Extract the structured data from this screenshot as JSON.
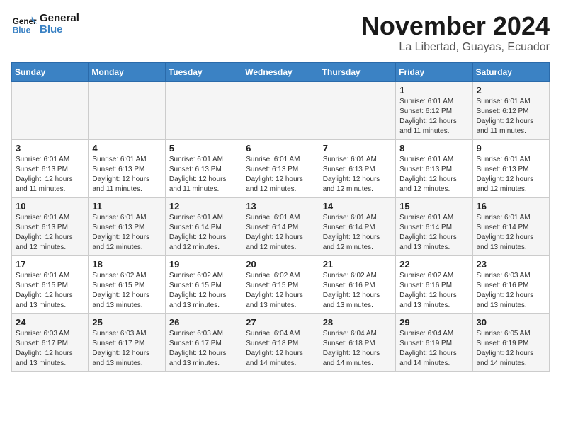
{
  "logo": {
    "line1": "General",
    "line2": "Blue"
  },
  "title": "November 2024",
  "subtitle": "La Libertad, Guayas, Ecuador",
  "days_of_week": [
    "Sunday",
    "Monday",
    "Tuesday",
    "Wednesday",
    "Thursday",
    "Friday",
    "Saturday"
  ],
  "weeks": [
    [
      {
        "day": "",
        "info": ""
      },
      {
        "day": "",
        "info": ""
      },
      {
        "day": "",
        "info": ""
      },
      {
        "day": "",
        "info": ""
      },
      {
        "day": "",
        "info": ""
      },
      {
        "day": "1",
        "info": "Sunrise: 6:01 AM\nSunset: 6:12 PM\nDaylight: 12 hours and 11 minutes."
      },
      {
        "day": "2",
        "info": "Sunrise: 6:01 AM\nSunset: 6:12 PM\nDaylight: 12 hours and 11 minutes."
      }
    ],
    [
      {
        "day": "3",
        "info": "Sunrise: 6:01 AM\nSunset: 6:13 PM\nDaylight: 12 hours and 11 minutes."
      },
      {
        "day": "4",
        "info": "Sunrise: 6:01 AM\nSunset: 6:13 PM\nDaylight: 12 hours and 11 minutes."
      },
      {
        "day": "5",
        "info": "Sunrise: 6:01 AM\nSunset: 6:13 PM\nDaylight: 12 hours and 11 minutes."
      },
      {
        "day": "6",
        "info": "Sunrise: 6:01 AM\nSunset: 6:13 PM\nDaylight: 12 hours and 12 minutes."
      },
      {
        "day": "7",
        "info": "Sunrise: 6:01 AM\nSunset: 6:13 PM\nDaylight: 12 hours and 12 minutes."
      },
      {
        "day": "8",
        "info": "Sunrise: 6:01 AM\nSunset: 6:13 PM\nDaylight: 12 hours and 12 minutes."
      },
      {
        "day": "9",
        "info": "Sunrise: 6:01 AM\nSunset: 6:13 PM\nDaylight: 12 hours and 12 minutes."
      }
    ],
    [
      {
        "day": "10",
        "info": "Sunrise: 6:01 AM\nSunset: 6:13 PM\nDaylight: 12 hours and 12 minutes."
      },
      {
        "day": "11",
        "info": "Sunrise: 6:01 AM\nSunset: 6:13 PM\nDaylight: 12 hours and 12 minutes."
      },
      {
        "day": "12",
        "info": "Sunrise: 6:01 AM\nSunset: 6:14 PM\nDaylight: 12 hours and 12 minutes."
      },
      {
        "day": "13",
        "info": "Sunrise: 6:01 AM\nSunset: 6:14 PM\nDaylight: 12 hours and 12 minutes."
      },
      {
        "day": "14",
        "info": "Sunrise: 6:01 AM\nSunset: 6:14 PM\nDaylight: 12 hours and 12 minutes."
      },
      {
        "day": "15",
        "info": "Sunrise: 6:01 AM\nSunset: 6:14 PM\nDaylight: 12 hours and 13 minutes."
      },
      {
        "day": "16",
        "info": "Sunrise: 6:01 AM\nSunset: 6:14 PM\nDaylight: 12 hours and 13 minutes."
      }
    ],
    [
      {
        "day": "17",
        "info": "Sunrise: 6:01 AM\nSunset: 6:15 PM\nDaylight: 12 hours and 13 minutes."
      },
      {
        "day": "18",
        "info": "Sunrise: 6:02 AM\nSunset: 6:15 PM\nDaylight: 12 hours and 13 minutes."
      },
      {
        "day": "19",
        "info": "Sunrise: 6:02 AM\nSunset: 6:15 PM\nDaylight: 12 hours and 13 minutes."
      },
      {
        "day": "20",
        "info": "Sunrise: 6:02 AM\nSunset: 6:15 PM\nDaylight: 12 hours and 13 minutes."
      },
      {
        "day": "21",
        "info": "Sunrise: 6:02 AM\nSunset: 6:16 PM\nDaylight: 12 hours and 13 minutes."
      },
      {
        "day": "22",
        "info": "Sunrise: 6:02 AM\nSunset: 6:16 PM\nDaylight: 12 hours and 13 minutes."
      },
      {
        "day": "23",
        "info": "Sunrise: 6:03 AM\nSunset: 6:16 PM\nDaylight: 12 hours and 13 minutes."
      }
    ],
    [
      {
        "day": "24",
        "info": "Sunrise: 6:03 AM\nSunset: 6:17 PM\nDaylight: 12 hours and 13 minutes."
      },
      {
        "day": "25",
        "info": "Sunrise: 6:03 AM\nSunset: 6:17 PM\nDaylight: 12 hours and 13 minutes."
      },
      {
        "day": "26",
        "info": "Sunrise: 6:03 AM\nSunset: 6:17 PM\nDaylight: 12 hours and 13 minutes."
      },
      {
        "day": "27",
        "info": "Sunrise: 6:04 AM\nSunset: 6:18 PM\nDaylight: 12 hours and 14 minutes."
      },
      {
        "day": "28",
        "info": "Sunrise: 6:04 AM\nSunset: 6:18 PM\nDaylight: 12 hours and 14 minutes."
      },
      {
        "day": "29",
        "info": "Sunrise: 6:04 AM\nSunset: 6:19 PM\nDaylight: 12 hours and 14 minutes."
      },
      {
        "day": "30",
        "info": "Sunrise: 6:05 AM\nSunset: 6:19 PM\nDaylight: 12 hours and 14 minutes."
      }
    ]
  ]
}
